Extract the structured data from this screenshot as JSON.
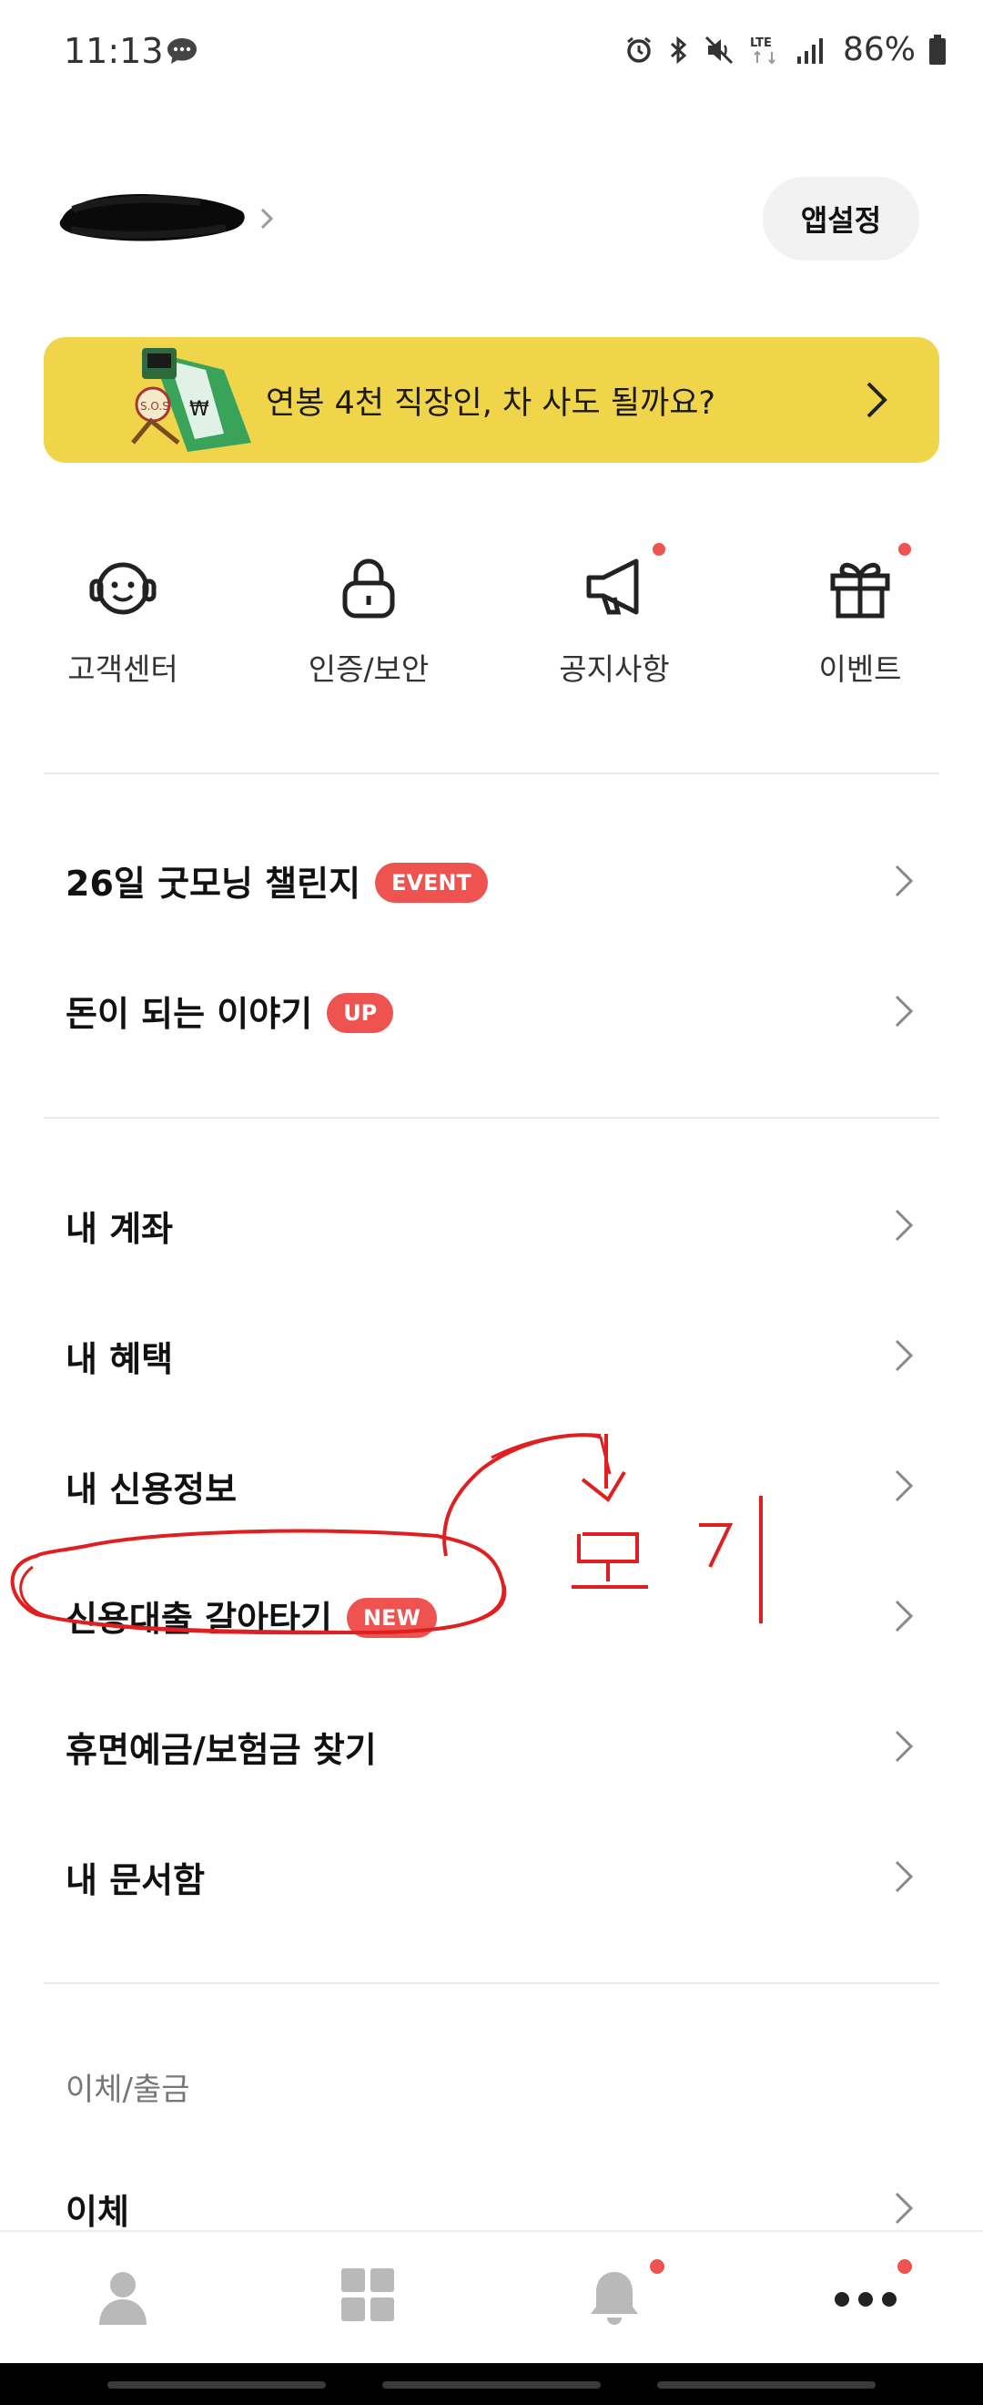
{
  "status_bar": {
    "time": "11:13",
    "network": "LTE",
    "battery": "86%"
  },
  "header": {
    "settings_label": "앱설정"
  },
  "banner": {
    "text": "연봉 4천 직장인, 차 사도 될까요?",
    "background": "#f0d44a"
  },
  "quick_menu": [
    {
      "label": "고객센터",
      "icon": "headset-icon",
      "has_dot": false
    },
    {
      "label": "인증/보안",
      "icon": "lock-icon",
      "has_dot": false
    },
    {
      "label": "공지사항",
      "icon": "megaphone-icon",
      "has_dot": true
    },
    {
      "label": "이벤트",
      "icon": "gift-icon",
      "has_dot": true
    }
  ],
  "promo_rows": [
    {
      "label": "26일 굿모닝 챌린지",
      "badge": "EVENT"
    },
    {
      "label": "돈이 되는 이야기",
      "badge": "UP"
    }
  ],
  "menu_rows": [
    {
      "label": "내 계좌"
    },
    {
      "label": "내 혜택"
    },
    {
      "label": "내 신용정보"
    },
    {
      "label": "신용대출 갈아타기",
      "badge": "NEW"
    },
    {
      "label": "휴면예금/보험금 찾기"
    },
    {
      "label": "내 문서함"
    }
  ],
  "transfer_section": {
    "caption": "이체/출금",
    "rows": [
      {
        "label": "이체"
      }
    ]
  },
  "bottom_nav": [
    {
      "icon": "person-icon",
      "has_dot": false
    },
    {
      "icon": "grid-icon",
      "has_dot": false
    },
    {
      "icon": "bell-icon",
      "has_dot": true
    },
    {
      "icon": "more-icon",
      "has_dot": true
    }
  ],
  "colors": {
    "accent_red": "#ef5350",
    "banner_yellow": "#f0d44a",
    "annotation_red": "#e02020"
  }
}
